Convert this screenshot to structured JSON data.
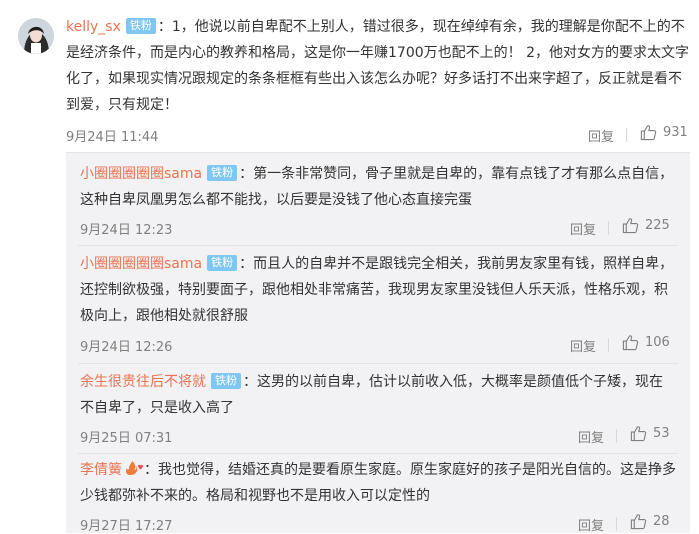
{
  "main_comment": {
    "username": "kelly_sx",
    "badge": "铁粉",
    "text": "：1，他说以前自卑配不上别人，错过很多，现在绰绰有余，我的理解是你配不上的不是经济条件，而是内心的教养和格局，这是你一年赚1700万也配不上的！ 2，他对女方的要求太文字化了，如果现实情况跟规定的条条框框有些出入该怎么办呢？好多话打不出来字超了，反正就是看不到爱，只有规定！",
    "time": "9月24日 11:44",
    "reply_label": "回复",
    "likes": "931"
  },
  "replies": [
    {
      "username": "小圈圈圈圈圈sama",
      "badge": "铁粉",
      "text": "：第一条非常赞同，骨子里就是自卑的，靠有点钱了才有那么点自信，这种自卑凤凰男怎么都不能找，以后要是没钱了他心态直接完蛋",
      "time": "9月24日 12:23",
      "reply_label": "回复",
      "likes": "225"
    },
    {
      "username": "小圈圈圈圈圈sama",
      "badge": "铁粉",
      "text": "：而且人的自卑并不是跟钱完全相关，我前男友家里有钱，照样自卑，还控制欲极强，特别要面子，跟他相处非常痛苦，我现男友家里没钱但人乐天派，性格乐观，积极向上，跟他相处就很舒服",
      "time": "9月24日 12:26",
      "reply_label": "回复",
      "likes": "106"
    },
    {
      "username": "余生很贵往后不将就",
      "badge": "铁粉",
      "text": "：这男的以前自卑，估计以前收入低，大概率是颜值低个子矮，现在不自卑了，只是收入高了",
      "time": "9月25日 07:31",
      "reply_label": "回复",
      "likes": "53"
    },
    {
      "username": "李倩簧",
      "badge": "",
      "text": "：我也觉得，结婚还真的是要看原生家庭。原生家庭好的孩子是阳光自信的。这是挣多少钱都弥补不来的。格局和视野也不是用收入可以定性的",
      "time": "9月27日 17:27",
      "reply_label": "回复",
      "likes": "28"
    }
  ],
  "colors": {
    "username": "#eb7350",
    "badge_bg": "#7fc7f0",
    "reply_bg": "#f2f2f5",
    "meta": "#808080"
  },
  "icons": {
    "like": "thumbs-up-icon",
    "fire": "fire-heart-icon"
  }
}
